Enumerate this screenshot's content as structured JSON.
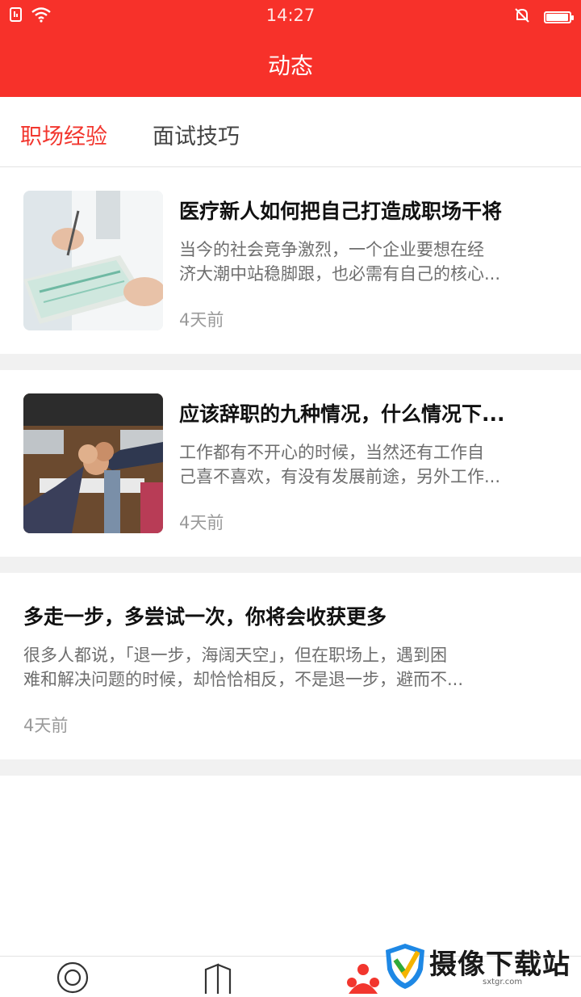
{
  "status_bar": {
    "time": "14:27",
    "left_icons": [
      "sim-icon",
      "wifi-icon"
    ],
    "right_icons": [
      "silent-bell-icon",
      "battery-icon"
    ],
    "battery_level": 0.95
  },
  "header": {
    "title": "动态"
  },
  "tabs": [
    {
      "label": "职场经验",
      "active": true
    },
    {
      "label": "面试技巧",
      "active": false
    }
  ],
  "articles": [
    {
      "title": "医疗新人如何把自己打造成职场干将",
      "desc_lines": [
        "当今的社会竞争激烈，一个企业要想在经",
        "济大潮中站稳脚跟，也必需有自己的核心..."
      ],
      "time": "4天前",
      "has_image": true
    },
    {
      "title": "应该辞职的九种情况，什么情况下...",
      "desc_lines": [
        "工作都有不开心的时候，当然还有工作自",
        "己喜不喜欢，有没有发展前途，另外工作..."
      ],
      "time": "4天前",
      "has_image": true
    },
    {
      "title": "多走一步，多尝试一次，你将会收获更多",
      "desc_lines": [
        "很多人都说，「退一步，海阔天空」，但在职场上，遇到困",
        "难和解决问题的时候，却恰恰相反，不是退一步，避而不..."
      ],
      "time": "4天前",
      "has_image": false
    }
  ],
  "bottom_nav": {
    "icons": [
      "circle-target-icon",
      "book-icon",
      "people-icon"
    ]
  },
  "watermark": {
    "text": "摄像下载站",
    "sub": "sxtgr.com"
  },
  "colors": {
    "accent": "#f7312a",
    "active_tab": "#f2362e",
    "separator": "#f1f1f1"
  }
}
